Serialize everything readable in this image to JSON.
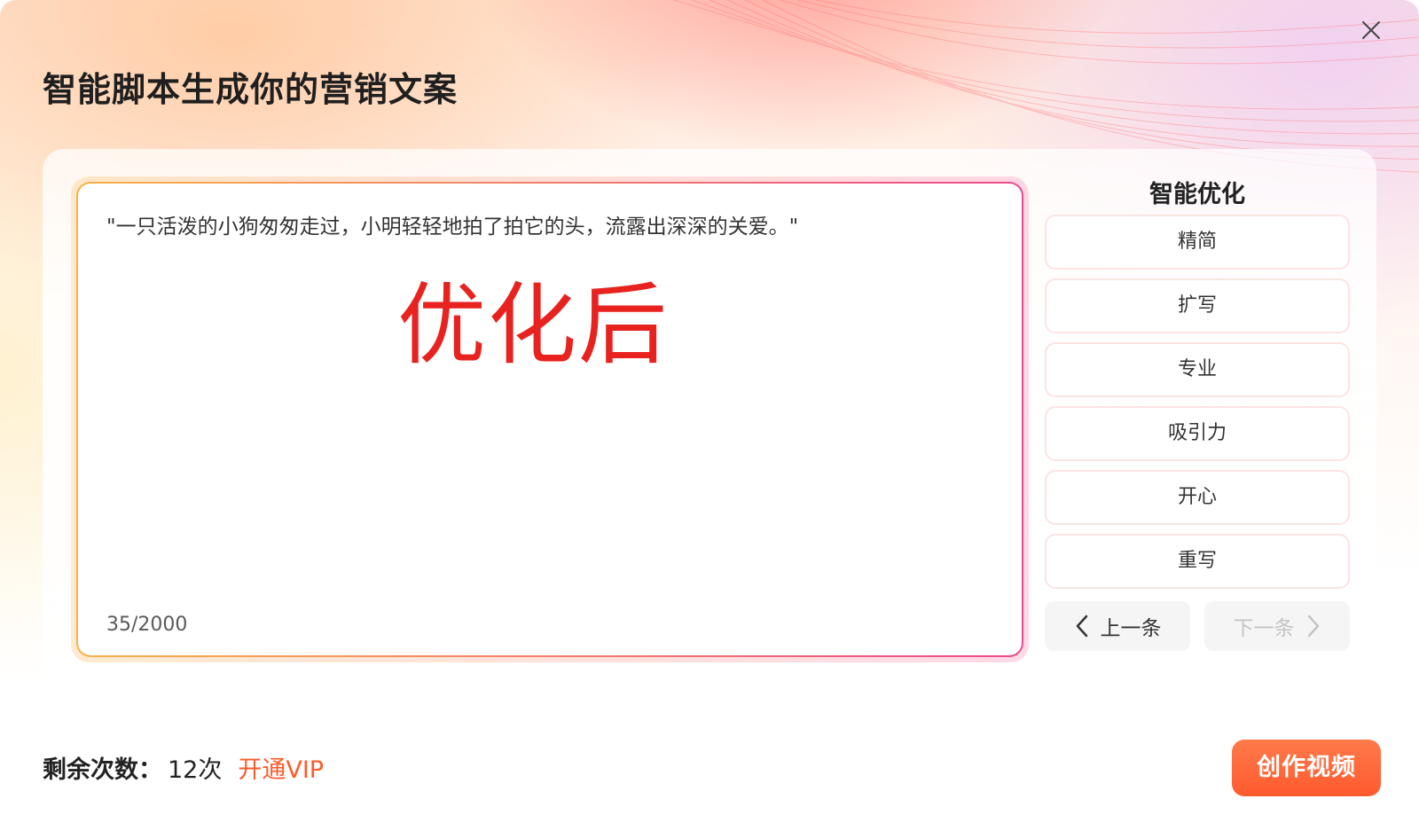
{
  "dialog": {
    "title": "智能脚本生成你的营销文案"
  },
  "editor": {
    "content": "\"一只活泼的小狗匆匆走过，小明轻轻地拍了拍它的头，流露出深深的关爱。\"",
    "overlay_label": "优化后",
    "char_count": "35/2000"
  },
  "sidebar": {
    "title": "智能优化",
    "options": [
      {
        "label": "精简"
      },
      {
        "label": "扩写"
      },
      {
        "label": "专业"
      },
      {
        "label": "吸引力"
      },
      {
        "label": "开心"
      },
      {
        "label": "重写"
      }
    ],
    "prev_label": "上一条",
    "next_label": "下一条"
  },
  "footer": {
    "quota_label": "剩余次数：",
    "quota_value": "12次",
    "vip_link": "开通VIP",
    "create_button": "创作视频"
  },
  "colors": {
    "accent": "#ff5a2a",
    "overlay_red": "#e8231f"
  },
  "icons": {
    "close": "close-icon",
    "prev": "chevron-left-icon",
    "next": "chevron-right-icon"
  }
}
